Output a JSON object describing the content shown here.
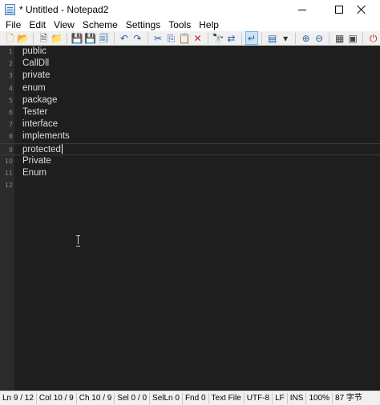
{
  "window": {
    "title": "* Untitled - Notepad2"
  },
  "menu": [
    "File",
    "Edit",
    "View",
    "Scheme",
    "Settings",
    "Tools",
    "Help"
  ],
  "toolbar": [
    {
      "name": "new-icon",
      "glyph": "🗋",
      "color": "#d88f1f"
    },
    {
      "name": "open-icon",
      "glyph": "📂",
      "color": "#d9a520"
    },
    {
      "sep": true
    },
    {
      "name": "new-file-icon",
      "glyph": "🗎",
      "color": "#555555"
    },
    {
      "name": "open-folder-icon",
      "glyph": "📁",
      "color": "#d9a520"
    },
    {
      "sep": true
    },
    {
      "name": "save-icon",
      "glyph": "💾",
      "color": "#2b5fae"
    },
    {
      "name": "save-as-icon",
      "glyph": "💾",
      "color": "#2b5fae"
    },
    {
      "name": "save-all-icon",
      "glyph": "🗐",
      "color": "#2b5fae"
    },
    {
      "sep": true
    },
    {
      "name": "undo-icon",
      "glyph": "↶",
      "color": "#2b5fae"
    },
    {
      "name": "redo-icon",
      "glyph": "↷",
      "color": "#2b5fae"
    },
    {
      "sep": true
    },
    {
      "name": "cut-icon",
      "glyph": "✂",
      "color": "#2b5fae"
    },
    {
      "name": "copy-icon",
      "glyph": "⎘",
      "color": "#2b5fae"
    },
    {
      "name": "paste-icon",
      "glyph": "📋",
      "color": "#b07a2a"
    },
    {
      "name": "delete-icon",
      "glyph": "✕",
      "color": "#c8281e"
    },
    {
      "sep": true
    },
    {
      "name": "find-icon",
      "glyph": "🔭",
      "color": "#2b5fae"
    },
    {
      "name": "replace-icon",
      "glyph": "⇄",
      "color": "#2b5fae"
    },
    {
      "sep": true
    },
    {
      "name": "word-wrap-icon",
      "glyph": "↵",
      "color": "#2b5fae",
      "selected": true
    },
    {
      "sep": true
    },
    {
      "name": "scheme-icon",
      "glyph": "▤",
      "color": "#2b5fae"
    },
    {
      "name": "dropdown-arrow-icon",
      "glyph": "▾",
      "color": "#333333"
    },
    {
      "sep": true
    },
    {
      "name": "zoom-in-icon",
      "glyph": "⊕",
      "color": "#2b5fae"
    },
    {
      "name": "zoom-out-icon",
      "glyph": "⊖",
      "color": "#2b5fae"
    },
    {
      "sep": true
    },
    {
      "name": "settings-icon",
      "glyph": "▦",
      "color": "#444444"
    },
    {
      "name": "view-icon",
      "glyph": "▣",
      "color": "#444444"
    },
    {
      "sep": true
    },
    {
      "name": "exit-icon",
      "glyph": "⏻",
      "color": "#c8281e"
    }
  ],
  "editor": {
    "current_line": 9,
    "lines": [
      {
        "num": "1",
        "text": "public"
      },
      {
        "num": "2",
        "text": "CallDll"
      },
      {
        "num": "3",
        "text": "private"
      },
      {
        "num": "4",
        "text": "enum"
      },
      {
        "num": "5",
        "text": "package"
      },
      {
        "num": "6",
        "text": "Tester"
      },
      {
        "num": "7",
        "text": "interface"
      },
      {
        "num": "8",
        "text": "implements"
      },
      {
        "num": "9",
        "text": "protected"
      },
      {
        "num": "10",
        "text": "Private"
      },
      {
        "num": "11",
        "text": "Enum"
      },
      {
        "num": "12",
        "text": ""
      }
    ]
  },
  "status": {
    "ln": "Ln 9 / 12",
    "col": "Col 10 / 9",
    "ch": "Ch 10 / 9",
    "sel": "Sel 0 / 0",
    "selln": "SelLn 0",
    "fnd": "Fnd 0",
    "filetype": "Text File",
    "encoding": "UTF-8",
    "eol": "LF",
    "mode": "INS",
    "zoom": "100%",
    "chars": "87 字节"
  }
}
